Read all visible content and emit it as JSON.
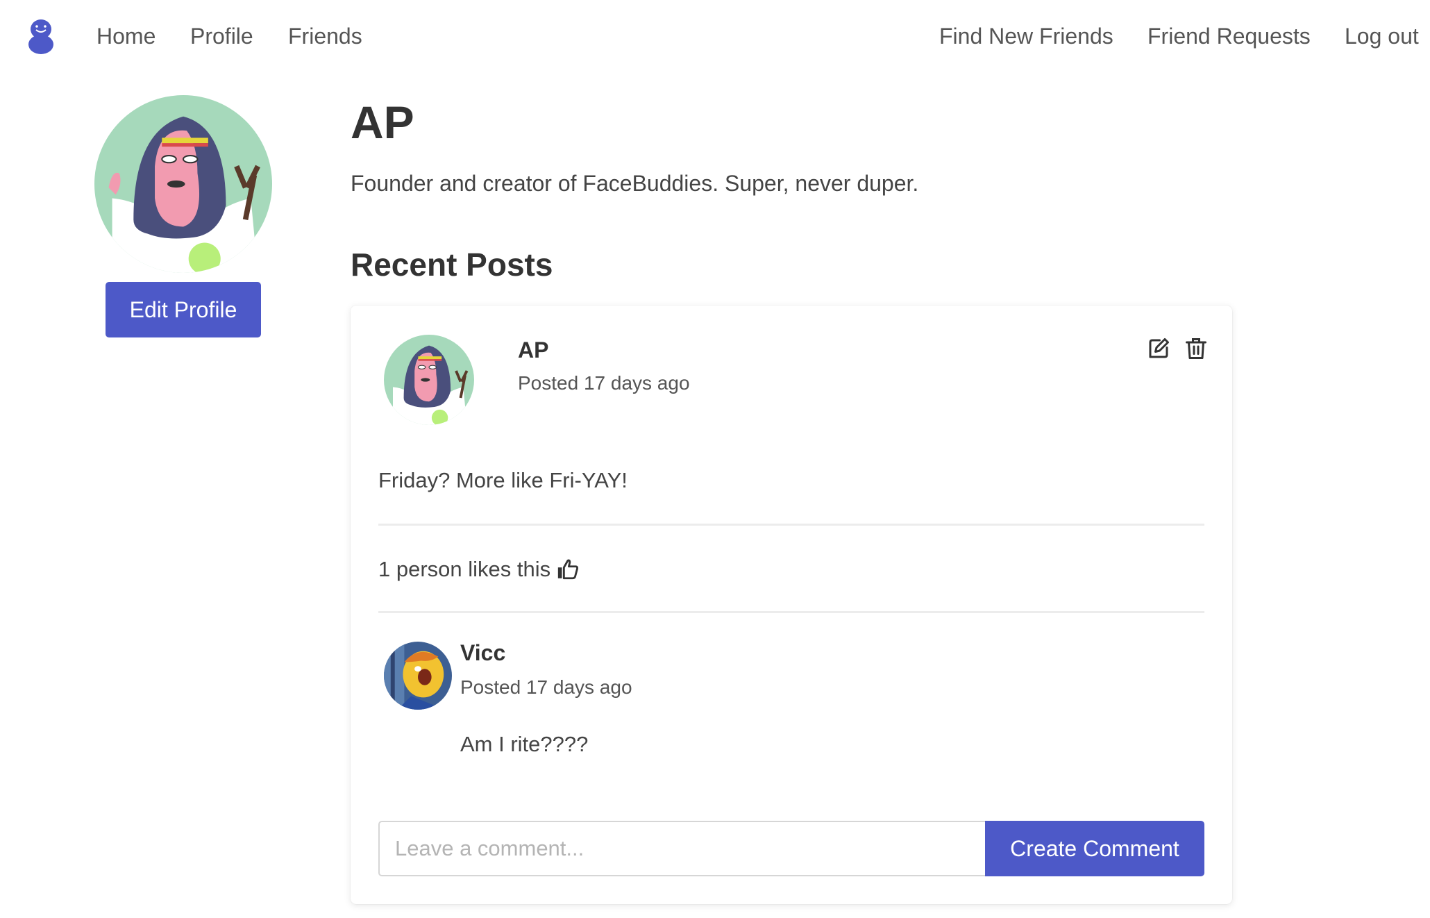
{
  "nav": {
    "left_links": [
      "Home",
      "Profile",
      "Friends"
    ],
    "right_links": [
      "Find New Friends",
      "Friend Requests",
      "Log out"
    ],
    "logo_icon": "buddy-logo-icon"
  },
  "profile": {
    "name": "AP",
    "bio": "Founder and creator of FaceBuddies. Super, never duper.",
    "edit_button": "Edit Profile"
  },
  "recent_posts_title": "Recent Posts",
  "post": {
    "author": "AP",
    "time": "Posted 17 days ago",
    "body": "Friday? More like Fri-YAY!",
    "likes": "1 person likes this",
    "icons": [
      "edit-icon",
      "trash-icon",
      "thumbs-up-icon"
    ]
  },
  "comments": [
    {
      "author": "Vicc",
      "time": "Posted 17 days ago",
      "body": "Am I rite????"
    }
  ],
  "comment_form": {
    "placeholder": "Leave a comment...",
    "button": "Create Comment"
  },
  "colors": {
    "accent": "#4d59c8",
    "avatar_bg": "#a6d9bb",
    "text": "#333333"
  }
}
